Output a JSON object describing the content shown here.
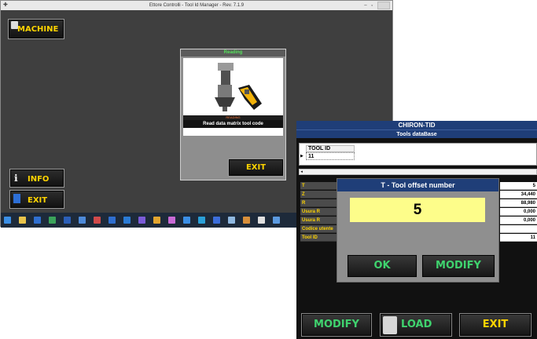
{
  "app_window": {
    "title": "Ettore Controlli - Tool Id Manager - Rev. 7.1.9",
    "controls": "– ▫",
    "machine_label": "MACHINE",
    "info_label": "INFO",
    "exit_label": "EXIT"
  },
  "reading_dialog": {
    "title": "Reading",
    "status": "READING",
    "message": "Read data matrix tool code",
    "exit_label": "EXIT"
  },
  "taskbar": {
    "icons": [
      "windows-logo",
      "explorer",
      "hp",
      "image",
      "word",
      "app",
      "pdf",
      "chart",
      "outlook",
      "vscode",
      "chrome",
      "paint",
      "app2",
      "app3",
      "app4",
      "app5",
      "app6",
      "app7",
      "app8"
    ]
  },
  "chiron": {
    "title": "CHIRON-TID",
    "subtitle": "Tools dataBase",
    "grid": {
      "header": "TOOL ID",
      "row_value": "11"
    },
    "properties": [
      {
        "label": "T",
        "value": "5"
      },
      {
        "label": "Z",
        "value": "34,440"
      },
      {
        "label": "R",
        "value": "88,980"
      },
      {
        "label": "Usura R",
        "value": "0,000"
      },
      {
        "label": "Usura R",
        "value": "0,000"
      },
      {
        "label": "Codice utente",
        "value": ""
      },
      {
        "label": "Tool ID",
        "value": "11"
      }
    ],
    "buttons": {
      "modify": "MODIFY",
      "load": "LOAD",
      "exit": "EXIT"
    }
  },
  "modal": {
    "title": "T - Tool offset number",
    "value": "5",
    "ok_label": "OK",
    "modify_label": "MODIFY"
  },
  "colors": {
    "accent_yellow": "#ffd400",
    "accent_green": "#3fd36e",
    "header_blue": "#1f3e78",
    "modal_input": "#fdfd8a"
  }
}
